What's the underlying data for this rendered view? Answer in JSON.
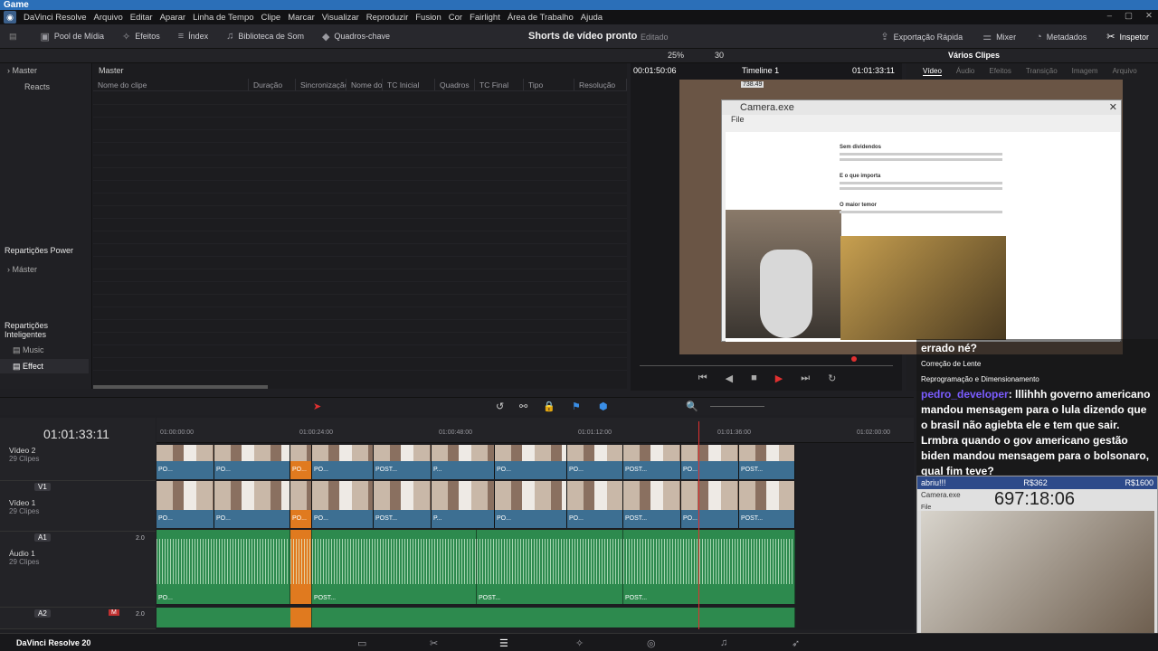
{
  "titlebar": {
    "title": "Game"
  },
  "menu": [
    "DaVinci Resolve",
    "Arquivo",
    "Editar",
    "Aparar",
    "Linha de Tempo",
    "Clipe",
    "Marcar",
    "Visualizar",
    "Reproduzir",
    "Fusion",
    "Cor",
    "Fairlight",
    "Área de Trabalho",
    "Ajuda"
  ],
  "toolbar": {
    "items": [
      {
        "label": "Pool de Mídia",
        "icon": "media-pool-icon"
      },
      {
        "label": "Efeitos",
        "icon": "effects-icon"
      },
      {
        "label": "Índex",
        "icon": "index-icon"
      },
      {
        "label": "Biblioteca de Som",
        "icon": "sound-library-icon"
      },
      {
        "label": "Quadros-chave",
        "icon": "keyframes-icon"
      }
    ],
    "project_title": "Shorts de vídeo pronto",
    "project_status": "Editado",
    "right_items": [
      {
        "label": "Exportação Rápida",
        "icon": "export-icon"
      },
      {
        "label": "Mixer",
        "icon": "mixer-icon"
      },
      {
        "label": "Metadados",
        "icon": "metadata-icon"
      },
      {
        "label": "Inspetor",
        "icon": "inspector-icon"
      }
    ]
  },
  "subbar": {
    "zoom": "25%",
    "fps": "30",
    "clips_label": "Vários Clipes"
  },
  "left_panel": {
    "root": "Master",
    "reacts": "Reacts",
    "power_bins_title": "Repartições Power",
    "power_master": "Máster",
    "smart_bins_title": "Repartições Inteligentes",
    "smart_items": [
      "Music",
      "Effect"
    ]
  },
  "bin": {
    "header": "Master",
    "columns": [
      "Nome do clipe",
      "Duração",
      "Sincronização",
      "Nome do f",
      "TC Inicial",
      "Quadros",
      "TC Final",
      "Tipo",
      "Resolução"
    ]
  },
  "viewer": {
    "timecode_left": "00:01:50:06",
    "timeline_name": "Timeline 1",
    "timecode_right": "01:01:33:11",
    "source_tag": "738.49"
  },
  "inspector_tabs": [
    "Vídeo",
    "Áudio",
    "Efeitos",
    "Transição",
    "Imagem",
    "Arquivo"
  ],
  "camera_window": {
    "title": "Camera.exe",
    "menu": "File",
    "doc_headings": [
      "Sem dividendos",
      "E o que importa",
      "O maior temor"
    ]
  },
  "chat": {
    "lines": [
      "errado né?",
      "Correção de Lente",
      "Reprogramação e Dimensionamento"
    ],
    "user": "pedro_developer",
    "message": ": lllihhh governo americano mandou mensagem para o lula dizendo que o brasil não agiebta ele e tem que sair. Lrmbra quando o gov americano gestão biden mandou mensagem para o bolsonaro, qual fim teve?"
  },
  "webcam": {
    "alert": "abriu!!!",
    "amount1": "R$362",
    "amount2": "R$1600",
    "title": "Camera.exe",
    "menu": "File",
    "timer": "697:18:06"
  },
  "timeline": {
    "big_timecode": "01:01:33:11",
    "ruler": [
      "01:00:00:00",
      "01:00:24:00",
      "01:00:48:00",
      "01:01:12:00",
      "01:01:36:00",
      "01:02:00:00"
    ],
    "tracks": [
      {
        "name": "Vídeo 2",
        "clips": "29 Clipes",
        "tag": ""
      },
      {
        "name": "Vídeo 1",
        "clips": "29 Clipes",
        "tag": "V1"
      },
      {
        "name": "Áudio 1",
        "clips": "29 Clipes",
        "tag": "A1",
        "level": "2.0"
      },
      {
        "name": "",
        "clips": "",
        "tag": "A2",
        "level": "2.0"
      }
    ],
    "clip_label_short": "PO...",
    "clip_label": "POST...",
    "clip_label_p": "P..."
  },
  "bottom": {
    "brand": "DaVinci Resolve 20"
  }
}
